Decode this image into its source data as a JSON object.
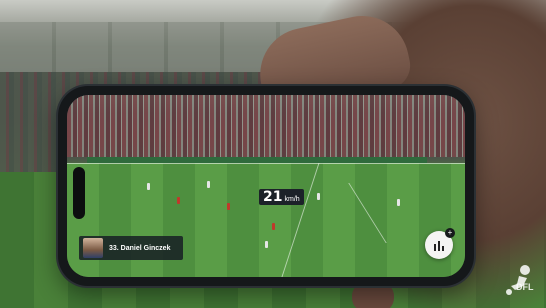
{
  "overlay": {
    "speed_value": "21",
    "speed_unit": "km/h",
    "player_label": "33. Daniel Ginczek",
    "stats_badge": "+"
  },
  "brand": {
    "logo_text": "DFL"
  },
  "icons": {
    "stats": "bar-chart-icon",
    "logo": "dfl-player-logo"
  },
  "colors": {
    "overlay_bg": "#1c2229",
    "stats_button": "#f4f4f2",
    "pitch": "#4e8f3f"
  }
}
